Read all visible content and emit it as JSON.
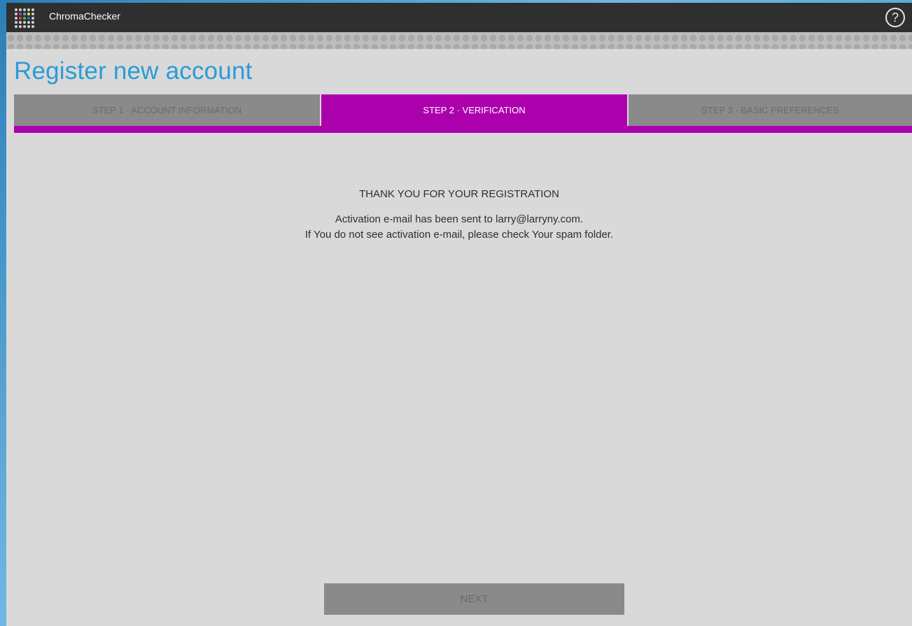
{
  "app": {
    "title": "ChromaChecker",
    "help_label": "?",
    "grid_colors": [
      "#cfcfcf",
      "#cfcfcf",
      "#cfcfcf",
      "#cfcfcf",
      "#cfcfcf",
      "#cfcfcf",
      "#e0309b",
      "#35b5e8",
      "#f2e43a",
      "#cfcfcf",
      "#cfcfcf",
      "#e9463f",
      "#3fbf5a",
      "#2f6fd8",
      "#cfcfcf",
      "#cfcfcf",
      "#cfcfcf",
      "#cfcfcf",
      "#cfcfcf",
      "#cfcfcf",
      "#cfcfcf",
      "#cfcfcf",
      "#cfcfcf",
      "#cfcfcf",
      "#cfcfcf"
    ]
  },
  "page": {
    "title": "Register new account"
  },
  "steps": [
    {
      "label": "STEP 1 · ACCOUNT INFORMATION",
      "active": false
    },
    {
      "label": "STEP 2 · VERIFICATION",
      "active": true
    },
    {
      "label": "STEP 3 · BASIC PREFERENCES",
      "active": false
    }
  ],
  "message": {
    "heading": "THANK YOU FOR YOUR REGISTRATION",
    "line1": "Activation e-mail has been sent to larry@larryny.com.",
    "line2": "If You do not see activation e-mail, please check Your spam folder."
  },
  "actions": {
    "next_label": "NEXT"
  },
  "colors": {
    "accent": "#ad00ad",
    "title": "#2b9bd6",
    "topbar": "#2f2f2f"
  }
}
